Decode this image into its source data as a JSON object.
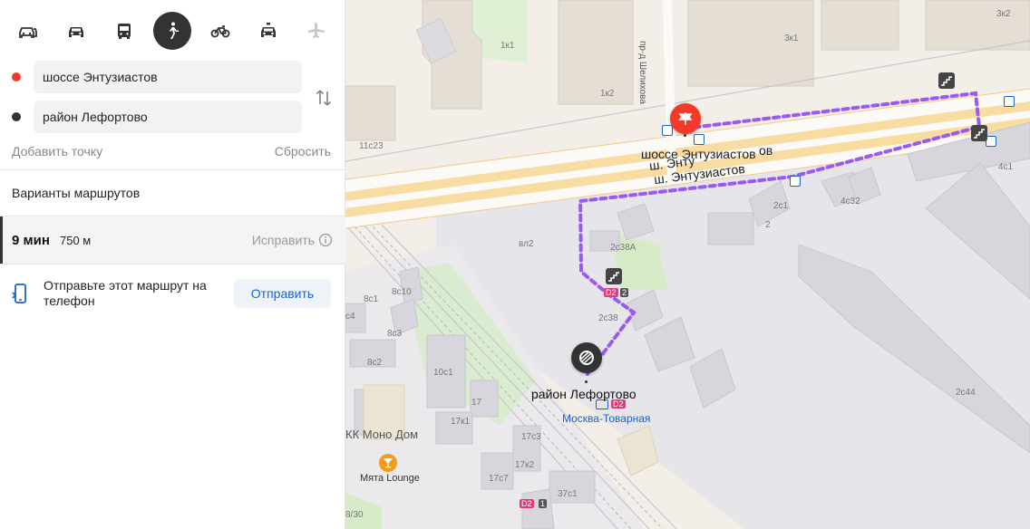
{
  "transport_modes": [
    {
      "icon": "car-traffic-icon",
      "active": false
    },
    {
      "icon": "car-icon",
      "active": false
    },
    {
      "icon": "bus-icon",
      "active": false
    },
    {
      "icon": "pedestrian-icon",
      "active": true
    },
    {
      "icon": "bicycle-icon",
      "active": false
    },
    {
      "icon": "taxi-icon",
      "active": false
    },
    {
      "icon": "airplane-icon",
      "active": false
    }
  ],
  "route": {
    "from": {
      "value": "шоссе Энтузиастов",
      "color": "#f33a2a"
    },
    "to": {
      "value": "район Лефортово",
      "color": "#333333"
    },
    "add_point": "Добавить точку",
    "reset": "Сбросить"
  },
  "variants": {
    "title": "Варианты маршрутов",
    "selected": {
      "time": "9 мин",
      "distance": "750 м",
      "fix": "Исправить"
    }
  },
  "send": {
    "text": "Отправьте этот маршрут на телефон",
    "button": "Отправить"
  },
  "map": {
    "accent_route": "#9b59f0",
    "labels": {
      "b_1k1": "1к1",
      "b_1k2": "1к2",
      "b_3k1": "3к1",
      "b_3k2": "3к2",
      "b_11c23": "11с23",
      "b_4c1": "4с1",
      "b_4c32": "4с32",
      "b_2c1": "2с1",
      "b_2": "2",
      "b_2c38a": "2с38А",
      "b_vl2": "вл2",
      "b_2c38": "2с38",
      "b_8c10": "8с10",
      "b_8c1": "8с1",
      "b_c4": "с4",
      "b_8c3": "8с3",
      "b_8c2": "8с2",
      "b_10c1": "10с1",
      "b_17": "17",
      "b_17k1": "17к1",
      "b_17c3": "17с3",
      "b_17k2": "17к2",
      "b_17c7": "17с7",
      "b_37c1": "37с1",
      "b_2c44": "2с44",
      "b_8_30": "8/30",
      "street_shelikova": "пр-д Шелихова",
      "street_entuz_1": "шоссе Энтузиастов",
      "street_entuz_ov": "ов",
      "street_entuz_2": "ш. Энту",
      "street_entuz_3": "ш. Энтузиастов",
      "poi_mono": "КК Моно Дом",
      "poi_myata": "Мята Lounge",
      "station": "Москва-Товарная",
      "end_label": "район Лефортово",
      "badge_d2": "D2",
      "badge_d2_num": "2",
      "badge_d2_b": "D2",
      "badge_d2_b_num": "1"
    }
  }
}
